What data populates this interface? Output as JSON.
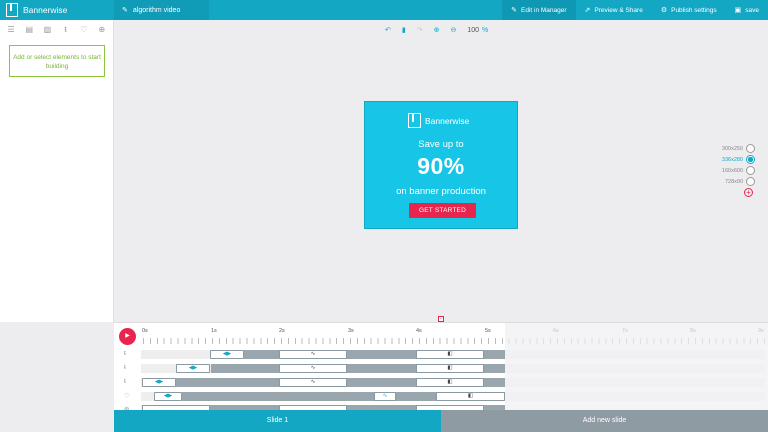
{
  "app": {
    "brand": "Bannerwise",
    "project_name": "algorithm video"
  },
  "topbar": {
    "edit_in_manager": "Edit in Manager",
    "preview_share": "Preview & Share",
    "publish_settings": "Publish settings",
    "save": "save"
  },
  "left_panel": {
    "hint": "Add or select elements to start building",
    "tool_icons": [
      "layers-icon",
      "file-icon",
      "image-icon",
      "text-icon",
      "shape-icon",
      "component-icon"
    ]
  },
  "canvas_toolbar": {
    "zoom": "100",
    "zoom_unit": "%"
  },
  "banner": {
    "brand": "Bannerwise",
    "line1": "Save up to",
    "big": "90%",
    "line2": "on banner production",
    "cta": "GET STARTED",
    "colors": {
      "background": "#17c6e6",
      "cta": "#e8254d"
    }
  },
  "sizes": {
    "options": [
      "300x250",
      "336x280",
      "160x600",
      "728x90"
    ],
    "selected": "336x280"
  },
  "timeline": {
    "tick_labels": [
      "0s",
      "1s",
      "2s",
      "3s",
      "4s",
      "5s",
      "6s",
      "7s",
      "8s",
      "9s"
    ],
    "current_end": "5s"
  },
  "footer": {
    "slide_label": "Slide 1",
    "add_slide": "Add new slide"
  },
  "colors": {
    "accent": "#13a7c4",
    "danger": "#e8254d",
    "success": "#8cc63f"
  }
}
